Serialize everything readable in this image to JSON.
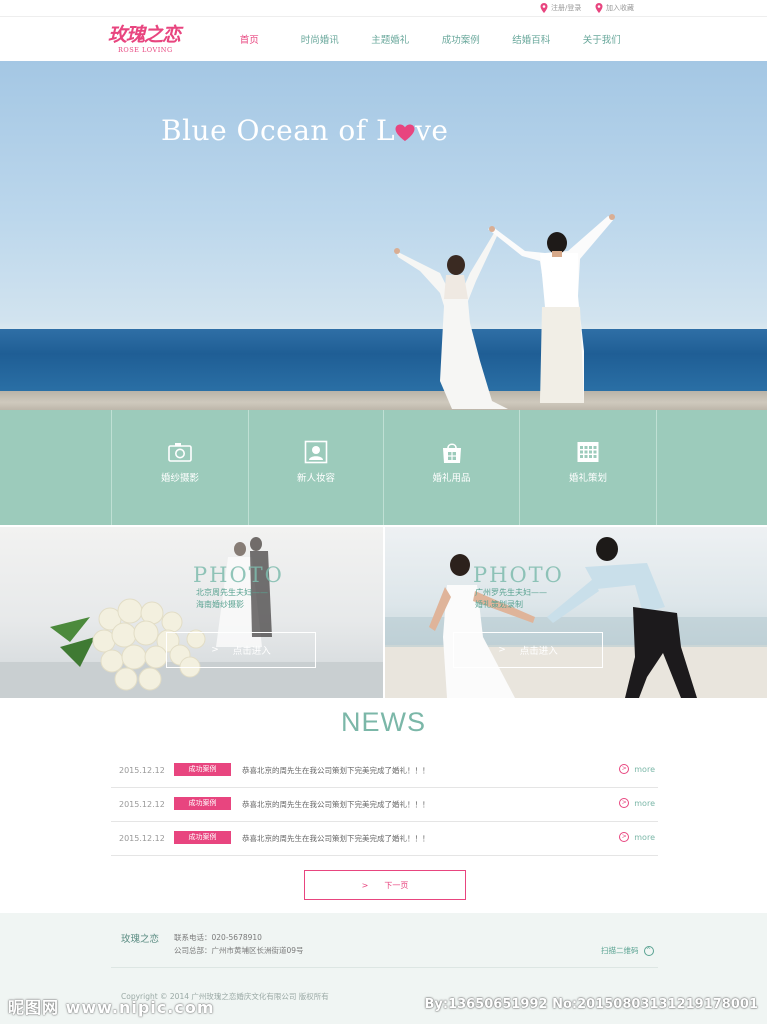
{
  "colors": {
    "brand_pink": "#e8457f",
    "mint": "#9ccbbb",
    "nav_teal": "#6aa89c",
    "news_teal": "#7bb7a8"
  },
  "topbar": {
    "links": [
      {
        "label": "注册/登录",
        "icon": "pin-icon"
      },
      {
        "label": "加入收藏",
        "icon": "pin-icon"
      }
    ]
  },
  "logo": {
    "cn": "玫瑰之恋",
    "en": "ROSE LOVING"
  },
  "nav": {
    "items": [
      {
        "label": "首页",
        "active": true
      },
      {
        "label": "时尚婚讯",
        "active": false
      },
      {
        "label": "主题婚礼",
        "active": false
      },
      {
        "label": "成功案例",
        "active": false
      },
      {
        "label": "结婚百科",
        "active": false
      },
      {
        "label": "关于我们",
        "active": false
      }
    ]
  },
  "hero": {
    "title_before": "Blue Ocean of L",
    "title_after": "ve"
  },
  "tiles": [
    {
      "label": "婚纱摄影",
      "icon": "camera-icon"
    },
    {
      "label": "新人妆容",
      "icon": "portrait-icon"
    },
    {
      "label": "婚礼用品",
      "icon": "shopping-bag-icon"
    },
    {
      "label": "婚礼策划",
      "icon": "calendar-icon"
    }
  ],
  "photos": [
    {
      "word": "PHOTO",
      "sub1": "北京周先生夫妇——",
      "sub2": "海南婚纱摄影",
      "button": "点击进入"
    },
    {
      "word": "PHOTO",
      "sub1": "广州罗先生夫妇——",
      "sub2": "婚礼策划录制",
      "button": "点击进入"
    }
  ],
  "news": {
    "title": "NEWS",
    "items": [
      {
        "date": "2015.12.12",
        "tag": "成功案例",
        "text": "恭喜北京的周先生在我公司策划下完美完成了婚礼！！！",
        "more": "more"
      },
      {
        "date": "2015.12.12",
        "tag": "成功案例",
        "text": "恭喜北京的周先生在我公司策划下完美完成了婚礼！！！",
        "more": "more"
      },
      {
        "date": "2015.12.12",
        "tag": "成功案例",
        "text": "恭喜北京的周先生在我公司策划下完美完成了婚礼！！！",
        "more": "more"
      }
    ],
    "next_label": "下一页"
  },
  "footer": {
    "brand": "玫瑰之恋",
    "phone": "联系电话：020-5678910",
    "address": "公司总部：广州市黄埔区长洲街道09号",
    "qr_label": "扫描二维码",
    "copyright": "Copyright © 2014 广州玫瑰之恋婚庆文化有限公司 版权所有"
  },
  "watermark": {
    "left": "昵图网 www.nipic.com",
    "right": "By:13650651992 No:20150803131219178001"
  }
}
